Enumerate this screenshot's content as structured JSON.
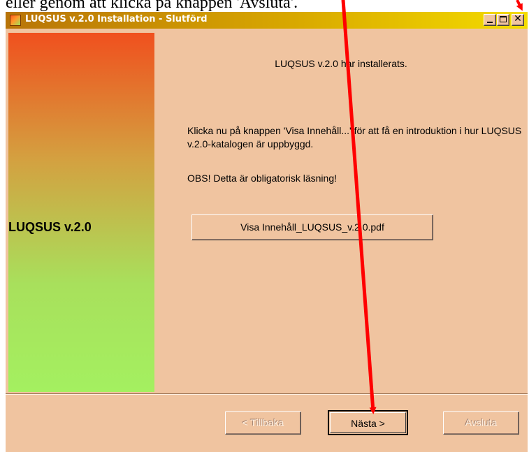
{
  "document": {
    "caption": "eller genom att klicka på knappen 'Avsluta'."
  },
  "window": {
    "title": "LUQSUS v.2.0 Installation - Slutförd",
    "titlebar_buttons": {
      "minimize_icon": "minimize-icon",
      "maximize_icon": "maximize-icon",
      "close_icon": "close-icon",
      "close_glyph": "✕"
    }
  },
  "sidebar": {
    "product_name": "LUQSUS v.2.0"
  },
  "content": {
    "headline": "LUQSUS v.2.0 har installerats.",
    "instruction": "Klicka nu på knappen 'Visa Innehåll...' för att få en introduktion i hur LUQSUS v.2.0-katalogen är uppbyggd.",
    "obs": "OBS! Detta är obligatorisk läsning!",
    "view_button_label": "Visa Innehåll_LUQSUS_v.2.0.pdf"
  },
  "footer": {
    "back_label": "< Tillbaka",
    "next_label": "Nästa >",
    "exit_label": "Avsluta"
  },
  "colors": {
    "window_bg": "#f0c4a0",
    "title_gradient_start": "#b87408",
    "title_gradient_end": "#f4dc00",
    "sidebar_top": "#f0501e",
    "sidebar_bottom": "#a4f060",
    "annotation_arrow": "#ff0000"
  }
}
